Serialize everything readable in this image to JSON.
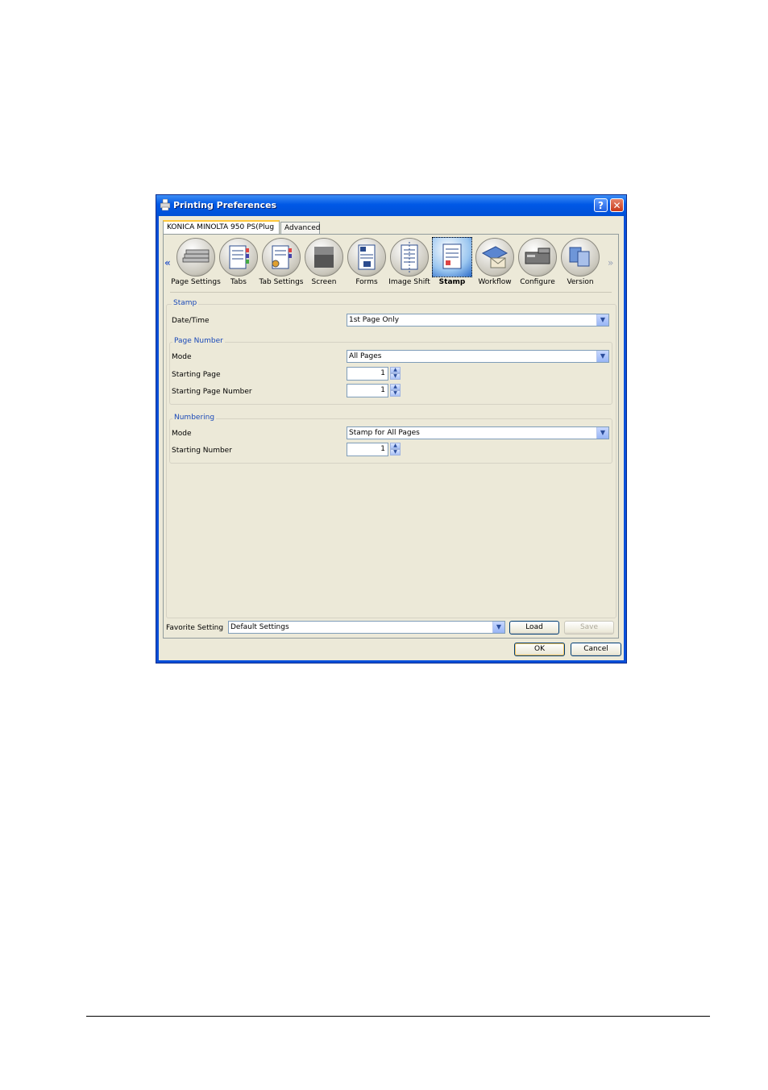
{
  "window": {
    "title": "Printing Preferences",
    "help_label": "?",
    "close_label": "✕"
  },
  "tabs": [
    {
      "label": "KONICA MINOLTA 950 PS(Plug"
    },
    {
      "label": "Advanced"
    }
  ],
  "toolbar": {
    "left_arrow": "«",
    "right_arrow": "»",
    "items": [
      {
        "label": "Page Settings",
        "icon": "page-settings-icon"
      },
      {
        "label": "Tabs",
        "icon": "tabs-icon"
      },
      {
        "label": "Tab Settings",
        "icon": "tab-settings-icon"
      },
      {
        "label": "Screen",
        "icon": "screen-icon"
      },
      {
        "label": "Forms",
        "icon": "forms-icon"
      },
      {
        "label": "Image Shift",
        "icon": "image-shift-icon"
      },
      {
        "label": "Stamp",
        "icon": "stamp-icon",
        "selected": true
      },
      {
        "label": "Workflow",
        "icon": "workflow-icon"
      },
      {
        "label": "Configure",
        "icon": "configure-icon"
      },
      {
        "label": "Version",
        "icon": "version-icon"
      }
    ]
  },
  "stamp": {
    "group_label": "Stamp",
    "date_time_label": "Date/Time",
    "date_time_value": "1st Page Only"
  },
  "page_number": {
    "group_label": "Page Number",
    "mode_label": "Mode",
    "mode_value": "All Pages",
    "starting_page_label": "Starting Page",
    "starting_page_value": "1",
    "starting_page_number_label": "Starting Page Number",
    "starting_page_number_value": "1"
  },
  "numbering": {
    "group_label": "Numbering",
    "mode_label": "Mode",
    "mode_value": "Stamp for All Pages",
    "starting_number_label": "Starting Number",
    "starting_number_value": "1"
  },
  "favorite": {
    "label": "Favorite Setting",
    "value": "Default Settings",
    "load_label": "Load",
    "save_label": "Save"
  },
  "footer": {
    "ok_label": "OK",
    "cancel_label": "Cancel"
  },
  "colors": {
    "titlebar": "#0058e6",
    "dialog_bg": "#ece9d8",
    "group_label": "#1a49b8"
  }
}
